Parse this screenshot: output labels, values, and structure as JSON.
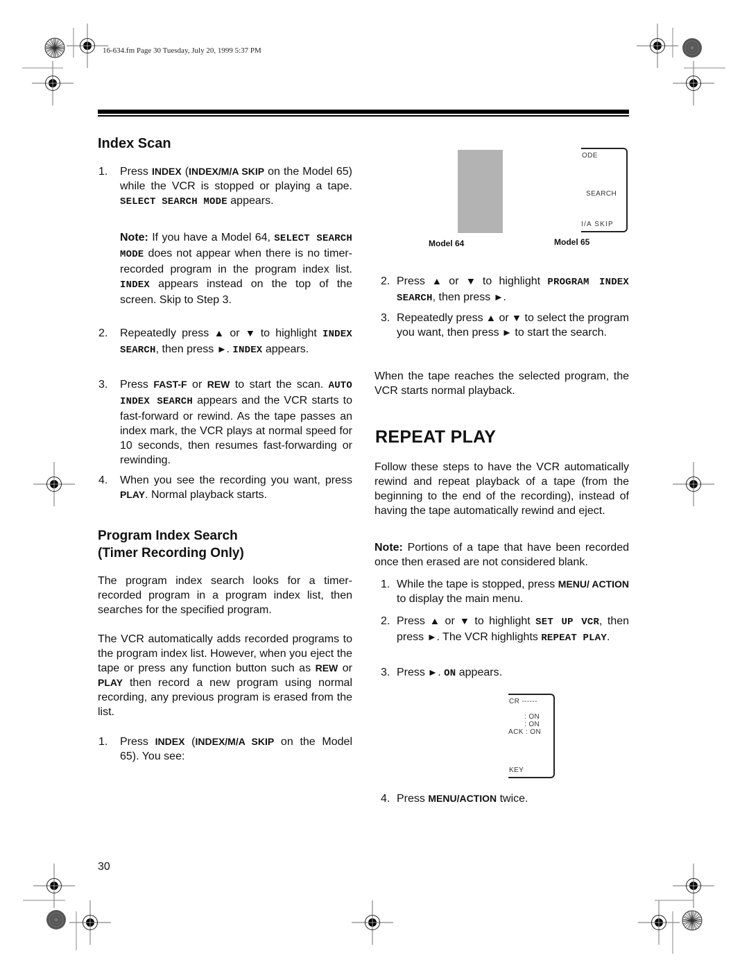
{
  "header": {
    "file_info": "16-634.fm  Page 30  Tuesday, July 20, 1999  5:37 PM"
  },
  "left": {
    "index_scan": {
      "title": "Index Scan",
      "step1": {
        "num": "1.",
        "t1": "Press ",
        "k1": "INDEX",
        "t2": " (",
        "k2": "INDEX/M/A SKIP",
        "t3": " on the Model 65) while the VCR is stopped or playing a tape. ",
        "osd1": "SELECT SEARCH MODE",
        "t4": " appears."
      },
      "note": {
        "label": "Note:",
        "t1": " If you have a Model 64, ",
        "osd1": "SELECT SEARCH MODE",
        "t2": " does not appear when there is no timer-recorded program in the program index list. ",
        "osd2": "INDEX",
        "t3": " appears instead on the top of the screen. Skip to Step 3."
      },
      "step2": {
        "num": "2.",
        "t1": "Repeatedly press ",
        "up": "▲",
        "t2": " or ",
        "down": "▼",
        "t3": " to highlight ",
        "osd1": "INDEX SEARCH",
        "t4": ", then press ",
        "right": "►",
        "t5": ". ",
        "osd2": "INDEX",
        "t6": " appears."
      },
      "step3": {
        "num": "3.",
        "t1": "Press ",
        "k1": "FAST-F",
        "t2": " or ",
        "k2": "REW",
        "t3": " to start the scan. ",
        "osd1": "AUTO INDEX SEARCH",
        "t4": " appears and the VCR starts to fast-forward or rewind. As the tape passes an index mark, the VCR plays at normal speed for 10 seconds, then resumes fast-forwarding or rewinding."
      },
      "step4": {
        "num": "4.",
        "t1": "When you see the recording you want, press ",
        "k1": "PLAY",
        "t2": ". Normal playback starts."
      }
    },
    "program_index": {
      "title_line1": "Program Index Search",
      "title_line2": "(Timer Recording Only)",
      "para1": "The program index search looks for a timer-recorded program in a program index list, then searches for the specified program.",
      "para2": {
        "t1": "The VCR automatically adds recorded programs to the program index list. However, when you eject the tape or press any function button such as ",
        "k1": "REW",
        "t2": " or ",
        "k2": "PLAY",
        "t3": " then record a new program using normal recording, any previous program is erased from the list."
      },
      "step1": {
        "num": "1.",
        "t1": "Press ",
        "k1": "INDEX",
        "t2": " (",
        "k2": "INDEX/M/A SKIP",
        "t3": " on the Model 65). You see:"
      }
    },
    "page_number": "30"
  },
  "figure_models": {
    "model64_label": "Model 64",
    "model65_label": "Model 65",
    "osd_lines": [
      "ODE",
      "SEARCH",
      "I/A SKIP"
    ]
  },
  "right": {
    "step2": {
      "num": "2.",
      "t1": "Press ",
      "up": "▲",
      "t2": " or ",
      "down": "▼",
      "t3": " to highlight ",
      "osd1": "PROGRAM INDEX SEARCH",
      "t4": ", then press ",
      "right": "►",
      "t5": "."
    },
    "step3": {
      "num": "3.",
      "t1": "Repeatedly press ",
      "up": "▲",
      "t2": " or ",
      "down": "▼",
      "t3": " to select the program you want, then press ",
      "right": "►",
      "t4": " to start the search."
    },
    "when_para": "When the tape reaches the selected program, the VCR starts normal playback.",
    "repeat_play": {
      "title": "REPEAT PLAY",
      "intro": "Follow these steps to have the VCR automatically rewind and repeat playback of a tape (from the beginning to the end of the recording), instead of having the tape automatically rewind and eject.",
      "note_label": "Note:",
      "note_text": " Portions of a tape that have been recorded once then erased are not considered blank.",
      "step1": {
        "num": "1.",
        "t1": "While the tape is stopped, press ",
        "k1": "MENU/ ACTION",
        "t2": " to display the main menu."
      },
      "step2": {
        "num": "2.",
        "t1": "Press ",
        "up": "▲",
        "t2": " or ",
        "down": "▼",
        "t3": " to highlight ",
        "osd1": "SET UP VCR",
        "t4": ", then press ",
        "right": "►",
        "t5": ". The VCR highlights ",
        "osd2": "REPEAT PLAY",
        "t6": "."
      },
      "step3": {
        "num": "3.",
        "t1": "Press ",
        "right": "►",
        "t2": ". ",
        "osd1": "ON",
        "t3": " appears."
      },
      "osd_figure": {
        "lines": [
          "CR ------",
          ": ON",
          ": ON",
          "ACK : ON",
          "KEY"
        ]
      },
      "step4": {
        "num": "4.",
        "t1": "Press ",
        "k1": "MENU/ACTION",
        "t2": " twice."
      }
    }
  }
}
